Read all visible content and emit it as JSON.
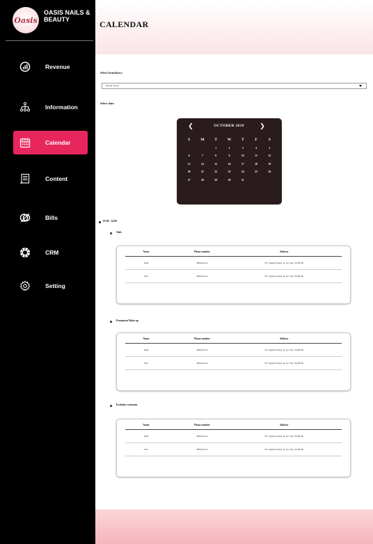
{
  "brand": {
    "logo_text": "Oasis",
    "name": "OASIS NAILS & BEAUTY"
  },
  "sidebar": {
    "items": [
      {
        "label": "Revenue",
        "icon": "revenue-icon"
      },
      {
        "label": "Information",
        "icon": "hierarchy-icon"
      },
      {
        "label": "Calendar",
        "icon": "calendar-icon",
        "active": true
      },
      {
        "label": "Content",
        "icon": "document-icon"
      },
      {
        "label": "Bills",
        "icon": "bills-icon"
      },
      {
        "label": "CRM",
        "icon": "crm-icon"
      },
      {
        "label": "Setting",
        "icon": "gear-icon"
      }
    ]
  },
  "colors": {
    "sidebar_bg": "#000000",
    "active": "#e8265e",
    "calendar_bg": "#2a1c1d",
    "header_pink": "#fbe4e6"
  },
  "header": {
    "title": "CALENDAR"
  },
  "branch": {
    "label": "Select branch(es):",
    "selected": "Quang Trung"
  },
  "date": {
    "label": "Select date:"
  },
  "calendar": {
    "title": "OCTOBER 2019",
    "weekdays": [
      "S",
      "M",
      "T",
      "W",
      "T",
      "F",
      "S"
    ],
    "weeks": [
      [
        "",
        "",
        "1",
        "2",
        "3",
        "4",
        "5"
      ],
      [
        "6",
        "7",
        "8",
        "9",
        "10",
        "11",
        "12"
      ],
      [
        "13",
        "14",
        "15",
        "16",
        "17",
        "18",
        "19"
      ],
      [
        "20",
        "21",
        "22",
        "23",
        "24",
        "25",
        "26"
      ],
      [
        "27",
        "28",
        "29",
        "30",
        "31",
        "",
        ""
      ]
    ]
  },
  "schedule": {
    "time_slot": "07:00 - 14:00",
    "columns": [
      "Name",
      "Phone number",
      "Address"
    ],
    "services": [
      {
        "name": "Nails",
        "rows": [
          [
            "Nam",
            "090xxxxxx",
            "317 Quang Trung, Q. Go Vap, Tp.HCM"
          ],
          [
            "Truc",
            "090xxxxxx",
            "317 Quang Trung, Q. Go Vap, Tp.HCM"
          ]
        ]
      },
      {
        "name": "Permanent Make-up",
        "rows": [
          [
            "Nam",
            "090xxxxxx",
            "317 Quang Trung, Q. Go Vap, Tp.HCM"
          ],
          [
            "Truc",
            "090xxxxxx",
            "317 Quang Trung, Q. Go Vap, Tp.HCM"
          ]
        ]
      },
      {
        "name": "Eyelasher extension",
        "rows": [
          [
            "Nam",
            "090xxxxxx",
            "317 Quang Trung, Q. Go Vap, Tp.HCM"
          ],
          [
            "Truc",
            "090xxxxxx",
            "317 Quang Trung, Q. Go Vap, Tp.HCM"
          ]
        ]
      }
    ]
  }
}
